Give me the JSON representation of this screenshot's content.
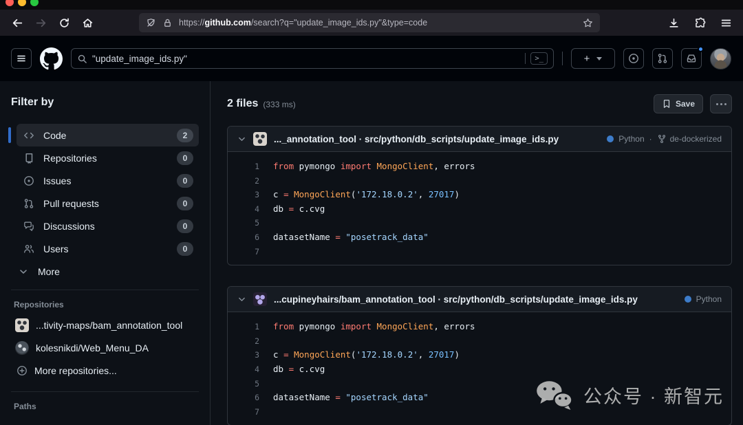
{
  "browser": {
    "url": {
      "scheme": "https://",
      "domain": "github.com",
      "path": "/search?q=\"update_image_ids.py\"&type=code"
    }
  },
  "gh_header": {
    "search_value": "\"update_image_ids.py\"",
    "command_hint": ">_",
    "plus_label": "+"
  },
  "sidebar": {
    "filter_title": "Filter by",
    "items": [
      {
        "label": "Code",
        "count": "2",
        "icon": "code-icon",
        "selected": true
      },
      {
        "label": "Repositories",
        "count": "0",
        "icon": "repo-icon",
        "selected": false
      },
      {
        "label": "Issues",
        "count": "0",
        "icon": "issue-icon",
        "selected": false
      },
      {
        "label": "Pull requests",
        "count": "0",
        "icon": "pull-request-icon",
        "selected": false
      },
      {
        "label": "Discussions",
        "count": "0",
        "icon": "discussion-icon",
        "selected": false
      },
      {
        "label": "Users",
        "count": "0",
        "icon": "users-icon",
        "selected": false
      }
    ],
    "more_label": "More",
    "repositories_title": "Repositories",
    "repositories": [
      {
        "name": "...tivity-maps/bam_annotation_tool",
        "avatar": "av-identicon-light"
      },
      {
        "name": "kolesnikdi/Web_Menu_DA",
        "avatar": "av-sphere-dark"
      }
    ],
    "more_repositories_label": "More repositories...",
    "paths_title": "Paths"
  },
  "results": {
    "count_label": "2 files",
    "time_label": "(333 ms)",
    "save_label": "Save",
    "cards": [
      {
        "title_repo": "..._annotation_tool",
        "title_sep": " · ",
        "title_path": "src/python/db_scripts/update_image_ids.py",
        "language": "Python",
        "language_color": "#3d7cc9",
        "branch": "de-dockerized",
        "avatar": "av-identicon-light",
        "code": [
          {
            "n": "1",
            "tokens": [
              [
                "k",
                "from"
              ],
              [
                "p",
                " pymongo "
              ],
              [
                "k",
                "import"
              ],
              [
                "f",
                " MongoClient"
              ],
              [
                "p",
                ", errors"
              ]
            ]
          },
          {
            "n": "2",
            "tokens": []
          },
          {
            "n": "3",
            "tokens": [
              [
                "p",
                "c "
              ],
              [
                "k",
                "="
              ],
              [
                "p",
                " "
              ],
              [
                "f",
                "MongoClient"
              ],
              [
                "p",
                "("
              ],
              [
                "s",
                "'172.18.0.2'"
              ],
              [
                "p",
                ", "
              ],
              [
                "n",
                "27017"
              ],
              [
                "p",
                ")"
              ]
            ]
          },
          {
            "n": "4",
            "tokens": [
              [
                "p",
                "db "
              ],
              [
                "k",
                "="
              ],
              [
                "p",
                " c.cvg"
              ]
            ]
          },
          {
            "n": "5",
            "tokens": []
          },
          {
            "n": "6",
            "tokens": [
              [
                "p",
                "datasetName "
              ],
              [
                "k",
                "="
              ],
              [
                "p",
                " "
              ],
              [
                "s",
                "\"posetrack_data\""
              ]
            ]
          },
          {
            "n": "7",
            "tokens": []
          }
        ]
      },
      {
        "title_repo": "...cupineyhairs/bam_annotation_tool",
        "title_sep": " · ",
        "title_path": "src/python/db_scripts/update_image_ids.py",
        "language": "Python",
        "language_color": "#3d7cc9",
        "branch": null,
        "avatar": "av-identicon-purple",
        "code": [
          {
            "n": "1",
            "tokens": [
              [
                "k",
                "from"
              ],
              [
                "p",
                " pymongo "
              ],
              [
                "k",
                "import"
              ],
              [
                "f",
                " MongoClient"
              ],
              [
                "p",
                ", errors"
              ]
            ]
          },
          {
            "n": "2",
            "tokens": []
          },
          {
            "n": "3",
            "tokens": [
              [
                "p",
                "c "
              ],
              [
                "k",
                "="
              ],
              [
                "p",
                " "
              ],
              [
                "f",
                "MongoClient"
              ],
              [
                "p",
                "("
              ],
              [
                "s",
                "'172.18.0.2'"
              ],
              [
                "p",
                ", "
              ],
              [
                "n",
                "27017"
              ],
              [
                "p",
                ")"
              ]
            ]
          },
          {
            "n": "4",
            "tokens": [
              [
                "p",
                "db "
              ],
              [
                "k",
                "="
              ],
              [
                "p",
                " c.cvg"
              ]
            ]
          },
          {
            "n": "5",
            "tokens": []
          },
          {
            "n": "6",
            "tokens": [
              [
                "p",
                "datasetName "
              ],
              [
                "k",
                "="
              ],
              [
                "p",
                " "
              ],
              [
                "s",
                "\"posetrack_data\""
              ]
            ]
          },
          {
            "n": "7",
            "tokens": []
          }
        ]
      }
    ]
  },
  "watermark": {
    "text": "公众号 · 新智元"
  }
}
